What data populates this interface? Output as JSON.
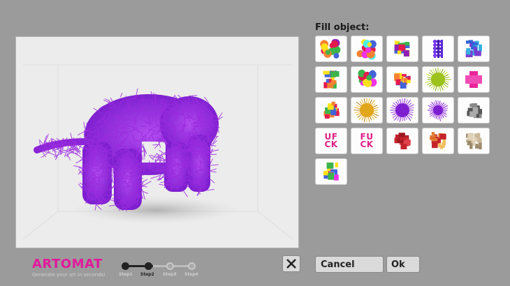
{
  "app": {
    "logo": "ARTOMAT",
    "tagline": "Generate your art in seconds!"
  },
  "preview": {
    "subject": "purple-spiky-elephant-render"
  },
  "fill_panel": {
    "title": "Fill object:",
    "thumbnails": [
      {
        "name": "fill-thumb-colored-cubes-cluster"
      },
      {
        "name": "fill-thumb-colored-spheres"
      },
      {
        "name": "fill-thumb-colored-blocks"
      },
      {
        "name": "fill-thumb-purple-grid"
      },
      {
        "name": "fill-thumb-head-blocks"
      },
      {
        "name": "fill-thumb-rainbow-sticks"
      },
      {
        "name": "fill-thumb-balls-and-blocks"
      },
      {
        "name": "fill-thumb-shards"
      },
      {
        "name": "fill-thumb-green-spiky"
      },
      {
        "name": "fill-thumb-pink-plus"
      },
      {
        "name": "fill-thumb-rainbow-cube"
      },
      {
        "name": "fill-thumb-golden-spiky"
      },
      {
        "name": "fill-thumb-purple-spiky-large"
      },
      {
        "name": "fill-thumb-purple-spiky-small"
      },
      {
        "name": "fill-thumb-gray-fragments"
      },
      {
        "name": "fill-thumb-text-ufck",
        "text": "UFCK"
      },
      {
        "name": "fill-thumb-text-fuck",
        "text": "FUCK"
      },
      {
        "name": "fill-thumb-red-boxes"
      },
      {
        "name": "fill-thumb-mixed-boxes"
      },
      {
        "name": "fill-thumb-beige-rocks"
      },
      {
        "name": "fill-thumb-colored-head"
      }
    ]
  },
  "steps": {
    "items": [
      "Step1",
      "Step2",
      "Step3",
      "Step4"
    ],
    "current": 2
  },
  "buttons": {
    "close_icon": "close-icon",
    "cancel": "Cancel",
    "ok": "Ok"
  },
  "colors": {
    "accent": "#e2199c",
    "fill_purple": "#9b2ce0",
    "background": "#9b9b9b"
  }
}
